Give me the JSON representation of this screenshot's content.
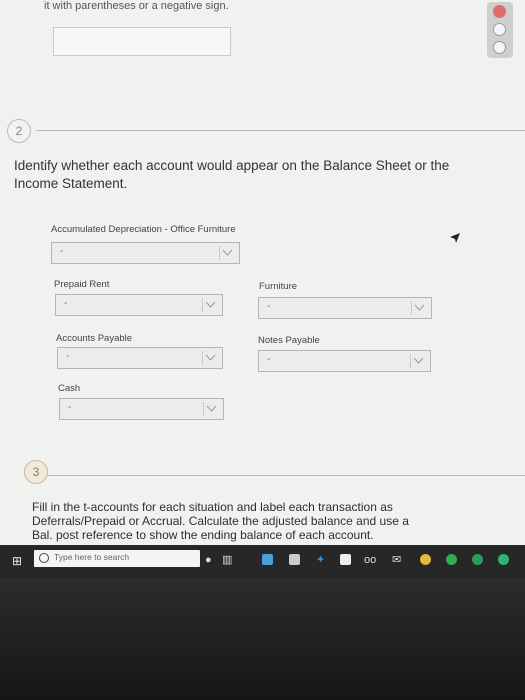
{
  "top": {
    "note": "it with parentheses or a negative sign."
  },
  "q2": {
    "number": "2",
    "prompt": "Identify whether each account would appear on the Balance Sheet or the Income Statement."
  },
  "accounts": [
    {
      "label": "Accumulated Depreciation - Office Furniture",
      "value": "-"
    },
    {
      "label": "Prepaid Rent",
      "value": "-"
    },
    {
      "label": "Furniture",
      "value": "-"
    },
    {
      "label": "Accounts Payable",
      "value": "-"
    },
    {
      "label": "Notes Payable",
      "value": "-"
    },
    {
      "label": "Cash",
      "value": "-"
    }
  ],
  "q3": {
    "number": "3",
    "prompt": "Fill in the t-accounts for each situation and label each transaction as Deferrals/Prepaid or Accrual. Calculate the adjusted balance and use a Bal. post reference to show the ending balance of each account."
  },
  "taskbar": {
    "search_placeholder": "Type here to search",
    "icons": [
      "windows-icon",
      "microphone-icon",
      "task-view-icon",
      "file-explorer-icon",
      "store-icon",
      "dropbox-icon",
      "amazon-icon",
      "tripadvisor-icon",
      "email-icon",
      "chrome-icon",
      "photos-icon",
      "green-app-icon",
      "app-icon"
    ]
  },
  "colors": {
    "page_bg": "#f1f1ef",
    "taskbar_bg": "#272727",
    "q3_badge": "#f3e9da"
  }
}
